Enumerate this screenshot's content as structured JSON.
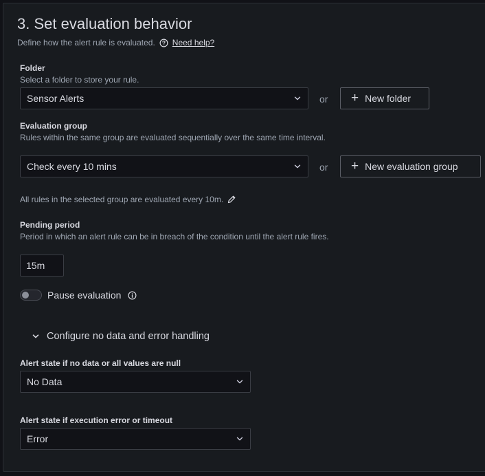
{
  "section": {
    "title": "3. Set evaluation behavior",
    "subtitle": "Define how the alert rule is evaluated.",
    "help_link": "Need help?"
  },
  "folder": {
    "label": "Folder",
    "description": "Select a folder to store your rule.",
    "selected": "Sensor Alerts",
    "or": "or",
    "new_button": "New folder"
  },
  "evaluation_group": {
    "label": "Evaluation group",
    "description": "Rules within the same group are evaluated sequentially over the same time interval.",
    "selected": "Check every 10 mins",
    "or": "or",
    "new_button": "New evaluation group",
    "note": "All rules in the selected group are evaluated every 10m."
  },
  "pending_period": {
    "label": "Pending period",
    "description": "Period in which an alert rule can be in breach of the condition until the alert rule fires.",
    "value": "15m"
  },
  "pause": {
    "label": "Pause evaluation",
    "enabled": false
  },
  "no_data_section": {
    "title": "Configure no data and error handling",
    "expanded": true,
    "no_data_label": "Alert state if no data or all values are null",
    "no_data_value": "No Data",
    "error_label": "Alert state if execution error or timeout",
    "error_value": "Error"
  },
  "icons": {
    "help": "question-circle-icon",
    "chevron": "chevron-down-icon",
    "plus": "plus-icon",
    "edit": "pencil-icon",
    "info": "info-circle-icon",
    "collapse": "angle-down-icon"
  },
  "colors": {
    "background": "#111217",
    "panel": "#181b1f",
    "text": "#d8d9e0",
    "secondary_text": "#9fa7b3",
    "border": "#3a3d44"
  }
}
